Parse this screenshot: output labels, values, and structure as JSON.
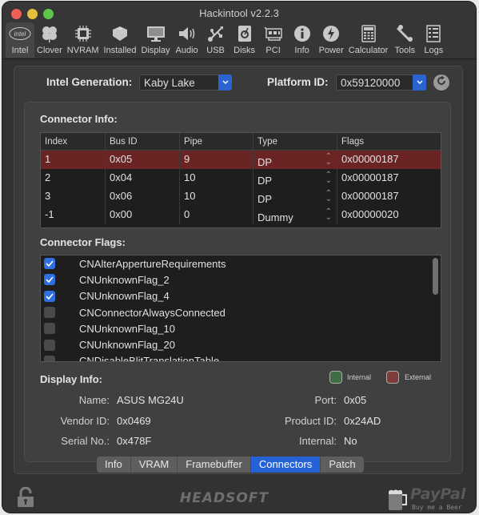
{
  "window": {
    "title": "Hackintool v2.2.3"
  },
  "toolbar": {
    "items": [
      {
        "label": "Intel",
        "icon": "intel-icon",
        "active": true
      },
      {
        "label": "Clover",
        "icon": "clover-icon"
      },
      {
        "label": "NVRAM",
        "icon": "chip-icon"
      },
      {
        "label": "Installed",
        "icon": "lego-brick-icon"
      },
      {
        "label": "Display",
        "icon": "monitor-icon"
      },
      {
        "label": "Audio",
        "icon": "speaker-icon"
      },
      {
        "label": "USB",
        "icon": "usb-icon"
      },
      {
        "label": "Disks",
        "icon": "disk-icon"
      },
      {
        "label": "PCI",
        "icon": "pci-card-icon"
      },
      {
        "label": "Info",
        "icon": "info-icon"
      },
      {
        "label": "Power",
        "icon": "power-bolt-icon"
      },
      {
        "label": "Calculator",
        "icon": "calculator-icon"
      },
      {
        "label": "Tools",
        "icon": "wrench-icon"
      },
      {
        "label": "Logs",
        "icon": "list-icon"
      }
    ]
  },
  "generation": {
    "label": "Intel Generation:",
    "value": "Kaby Lake"
  },
  "platform": {
    "label": "Platform ID:",
    "value": "0x59120000"
  },
  "connector_info": {
    "title": "Connector Info:",
    "columns": [
      "Index",
      "Bus ID",
      "Pipe",
      "Type",
      "Flags"
    ],
    "rows": [
      {
        "index": "1",
        "bus_id": "0x05",
        "pipe": "9",
        "type": "DP",
        "flags": "0x00000187",
        "selected": true
      },
      {
        "index": "2",
        "bus_id": "0x04",
        "pipe": "10",
        "type": "DP",
        "flags": "0x00000187"
      },
      {
        "index": "3",
        "bus_id": "0x06",
        "pipe": "10",
        "type": "DP",
        "flags": "0x00000187"
      },
      {
        "index": "-1",
        "bus_id": "0x00",
        "pipe": "0",
        "type": "Dummy",
        "flags": "0x00000020"
      }
    ]
  },
  "connector_flags": {
    "title": "Connector Flags:",
    "items": [
      {
        "label": "CNAlterAppertureRequirements",
        "checked": true
      },
      {
        "label": "CNUnknownFlag_2",
        "checked": true
      },
      {
        "label": "CNUnknownFlag_4",
        "checked": true
      },
      {
        "label": "CNConnectorAlwaysConnected",
        "checked": false
      },
      {
        "label": "CNUnknownFlag_10",
        "checked": false
      },
      {
        "label": "CNUnknownFlag_20",
        "checked": false
      },
      {
        "label": "CNDisableBlitTranslationTable",
        "checked": false
      }
    ]
  },
  "display_info": {
    "title": "Display Info:",
    "legend": {
      "internal": "Internal",
      "external": "External",
      "internal_color": "#3f6e45",
      "external_color": "#7a3d3a"
    },
    "name_label": "Name:",
    "name": "ASUS MG24U",
    "vendor_label": "Vendor ID:",
    "vendor": "0x0469",
    "serial_label": "Serial No.:",
    "serial": "0x478F",
    "port_label": "Port:",
    "port": "0x05",
    "product_label": "Product ID:",
    "product": "0x24AD",
    "internal_label": "Internal:",
    "internal": "No"
  },
  "tabs": [
    "Info",
    "VRAM",
    "Framebuffer",
    "Connectors",
    "Patch"
  ],
  "active_tab": "Connectors",
  "footer": {
    "logo": "HEADSOFT",
    "paypal": "PayPal",
    "paypal_sub": "Buy me a Beer"
  }
}
